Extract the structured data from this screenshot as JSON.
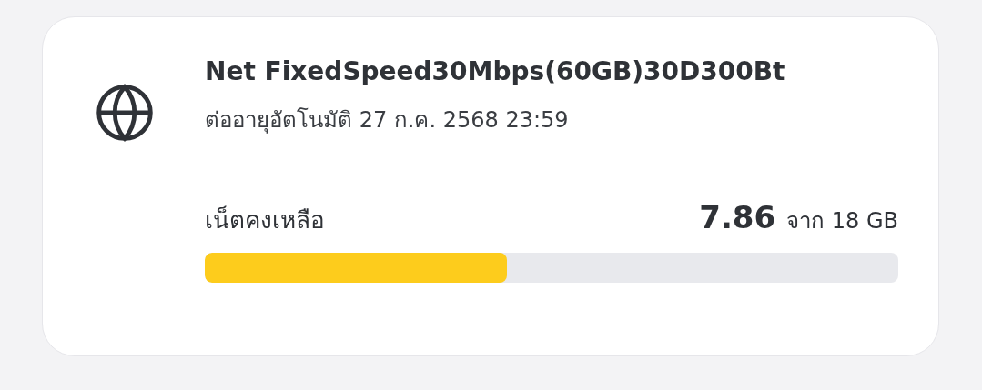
{
  "package": {
    "title": "Net FixedSpeed30Mbps(60GB)30D300Bt",
    "renewal": "ต่ออายุอัตโนมัติ 27 ก.ค. 2568 23:59"
  },
  "usage": {
    "label": "เน็ตคงเหลือ",
    "remaining": "7.86",
    "total": "จาก 18 GB",
    "level": 0.436
  }
}
